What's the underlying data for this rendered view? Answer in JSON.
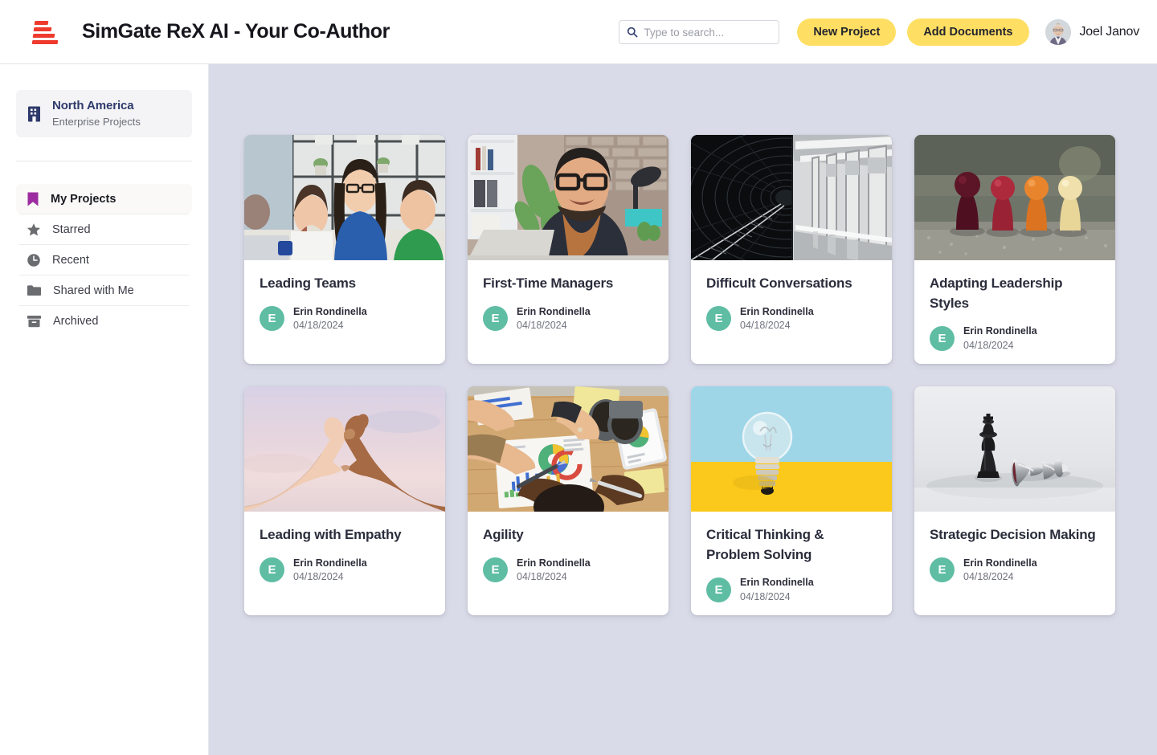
{
  "header": {
    "logo_icon": "simgate-bars-logo",
    "app_title": "SimGate ReX AI - Your Co-Author",
    "search": {
      "icon": "search-icon",
      "placeholder": "Type to search...",
      "value": ""
    },
    "buttons": [
      {
        "label": "New Project",
        "name": "new-project-button"
      },
      {
        "label": "Add Documents",
        "name": "add-documents-button"
      }
    ],
    "user": {
      "name": "Joel Janov",
      "avatar_icon": "user-avatar-photo"
    }
  },
  "sidebar": {
    "org": {
      "icon": "building-icon",
      "title": "North America",
      "subtitle": "Enterprise Projects"
    },
    "items": [
      {
        "label": "My Projects",
        "icon": "bookmark-icon",
        "active": true
      },
      {
        "label": "Starred",
        "icon": "star-icon",
        "active": false
      },
      {
        "label": "Recent",
        "icon": "clock-icon",
        "active": false
      },
      {
        "label": "Shared with Me",
        "icon": "folder-icon",
        "active": false
      },
      {
        "label": "Archived",
        "icon": "archive-icon",
        "active": false
      }
    ]
  },
  "colors": {
    "accent_yellow": "#ffdf63",
    "logo_red": "#ee3b2e",
    "org_navy": "#2e3a6b",
    "bookmark_purple": "#9c2ca0",
    "avatar_teal": "#5fbda4",
    "main_background": "#d9dbe8"
  },
  "main": {
    "cards": [
      {
        "title": "Leading Teams",
        "author": "Erin Rondinella",
        "date": "04/18/2024",
        "avatar_initial": "E",
        "thumbnail": "office-team-meeting-photo"
      },
      {
        "title": "First-Time Managers",
        "author": "Erin Rondinella",
        "date": "04/18/2024",
        "avatar_initial": "E",
        "thumbnail": "man-at-laptop-office-photo"
      },
      {
        "title": "Difficult Conversations",
        "author": "Erin Rondinella",
        "date": "04/18/2024",
        "avatar_initial": "E",
        "thumbnail": "black-white-subway-tunnel-photo"
      },
      {
        "title": "Adapting Leadership Styles",
        "author": "Erin Rondinella",
        "date": "04/18/2024",
        "avatar_initial": "E",
        "thumbnail": "wooden-game-pawns-photo"
      },
      {
        "title": "Leading with Empathy",
        "author": "Erin Rondinella",
        "date": "04/18/2024",
        "avatar_initial": "E",
        "thumbnail": "hands-forming-heart-photo"
      },
      {
        "title": "Agility",
        "author": "Erin Rondinella",
        "date": "04/18/2024",
        "avatar_initial": "E",
        "thumbnail": "team-reviewing-charts-photo"
      },
      {
        "title": "Critical Thinking & Problem Solving",
        "author": "Erin Rondinella",
        "date": "04/18/2024",
        "avatar_initial": "E",
        "thumbnail": "lightbulb-blue-yellow-photo"
      },
      {
        "title": "Strategic Decision Making",
        "author": "Erin Rondinella",
        "date": "04/18/2024",
        "avatar_initial": "E",
        "thumbnail": "chess-pieces-photo"
      }
    ]
  }
}
